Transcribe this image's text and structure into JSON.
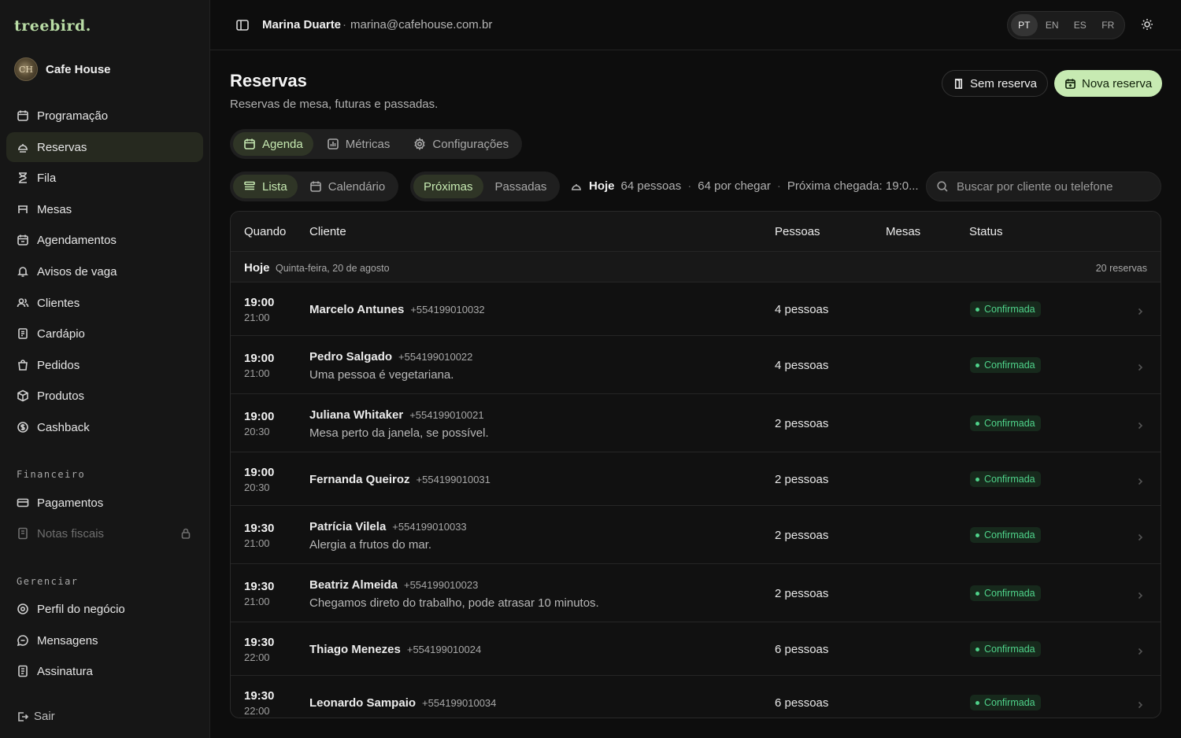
{
  "brand": "treebird.",
  "venue": {
    "name": "Cafe House",
    "logo_text": "CH"
  },
  "sidebar": {
    "items": [
      {
        "label": "Programação",
        "icon": "calendar-icon"
      },
      {
        "label": "Reservas",
        "icon": "reservation-icon"
      },
      {
        "label": "Fila",
        "icon": "hourglass-icon"
      },
      {
        "label": "Mesas",
        "icon": "table-icon"
      },
      {
        "label": "Agendamentos",
        "icon": "calendar-icon"
      },
      {
        "label": "Avisos de vaga",
        "icon": "bell-icon"
      },
      {
        "label": "Clientes",
        "icon": "users-icon"
      },
      {
        "label": "Cardápio",
        "icon": "menu-book-icon"
      },
      {
        "label": "Pedidos",
        "icon": "bag-icon"
      },
      {
        "label": "Produtos",
        "icon": "box-icon"
      },
      {
        "label": "Cashback",
        "icon": "coin-icon"
      }
    ],
    "financeiro_label": "Financeiro",
    "financeiro": [
      {
        "label": "Pagamentos",
        "icon": "card-icon"
      },
      {
        "label": "Notas fiscais",
        "icon": "receipt-icon"
      }
    ],
    "gerenciar_label": "Gerenciar",
    "gerenciar": [
      {
        "label": "Perfil do negócio",
        "icon": "location-icon"
      },
      {
        "label": "Mensagens",
        "icon": "chat-icon"
      },
      {
        "label": "Assinatura",
        "icon": "document-icon"
      }
    ],
    "logout": "Sair"
  },
  "topbar": {
    "user_name": "Marina Duarte",
    "separator": "·",
    "user_email": "marina@cafehouse.com.br",
    "languages": [
      "PT",
      "EN",
      "ES",
      "FR"
    ],
    "active_language": "PT"
  },
  "header": {
    "title": "Reservas",
    "subtitle": "Reservas de mesa, futuras e passadas.",
    "walkin_button": "Sem reserva",
    "new_button": "Nova reserva"
  },
  "tabs": [
    "Agenda",
    "Métricas",
    "Configurações"
  ],
  "view_toggle": [
    "Lista",
    "Calendário"
  ],
  "time_toggle": [
    "Próximas",
    "Passadas"
  ],
  "summary": {
    "today": "Hoje",
    "people": "64 pessoas",
    "arriving": "64 por chegar",
    "next_arrival": "Próxima chegada: 19:0..."
  },
  "search": {
    "placeholder": "Buscar por cliente ou telefone"
  },
  "table": {
    "headers": {
      "when": "Quando",
      "client": "Cliente",
      "people": "Pessoas",
      "tables": "Mesas",
      "status": "Status"
    },
    "group": {
      "label": "Hoje",
      "date": "Quinta-feira, 20 de agosto",
      "count": "20 reservas"
    },
    "rows": [
      {
        "start": "19:00",
        "end": "21:00",
        "name": "Marcelo Antunes",
        "phone": "+554199010032",
        "note": "",
        "people": "4 pessoas",
        "status": "Confirmada"
      },
      {
        "start": "19:00",
        "end": "21:00",
        "name": "Pedro Salgado",
        "phone": "+554199010022",
        "note": "Uma pessoa é vegetariana.",
        "people": "4 pessoas",
        "status": "Confirmada"
      },
      {
        "start": "19:00",
        "end": "20:30",
        "name": "Juliana Whitaker",
        "phone": "+554199010021",
        "note": "Mesa perto da janela, se possível.",
        "people": "2 pessoas",
        "status": "Confirmada"
      },
      {
        "start": "19:00",
        "end": "20:30",
        "name": "Fernanda Queiroz",
        "phone": "+554199010031",
        "note": "",
        "people": "2 pessoas",
        "status": "Confirmada"
      },
      {
        "start": "19:30",
        "end": "21:00",
        "name": "Patrícia Vilela",
        "phone": "+554199010033",
        "note": "Alergia a frutos do mar.",
        "people": "2 pessoas",
        "status": "Confirmada"
      },
      {
        "start": "19:30",
        "end": "21:00",
        "name": "Beatriz Almeida",
        "phone": "+554199010023",
        "note": "Chegamos direto do trabalho, pode atrasar 10 minutos.",
        "people": "2 pessoas",
        "status": "Confirmada"
      },
      {
        "start": "19:30",
        "end": "22:00",
        "name": "Thiago Menezes",
        "phone": "+554199010024",
        "note": "",
        "people": "6 pessoas",
        "status": "Confirmada"
      },
      {
        "start": "19:30",
        "end": "22:00",
        "name": "Leonardo Sampaio",
        "phone": "+554199010034",
        "note": "",
        "people": "6 pessoas",
        "status": "Confirmada"
      }
    ]
  },
  "colors": {
    "accent": "#c7eab2",
    "status_confirmed": "#4fd38a",
    "background": "#0d0d0d"
  }
}
